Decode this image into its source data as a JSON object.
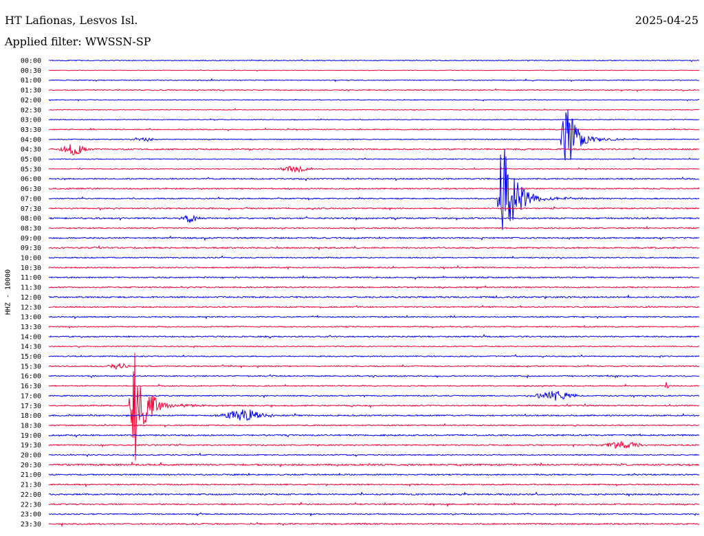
{
  "header": {
    "station": "HT Lafionas, Lesvos Isl.",
    "date": "2025-04-25",
    "filter_line": "Applied filter: WWSSN-SP",
    "channel_label": "HHZ - 10000"
  },
  "colors": {
    "even_trace": "#0000ee",
    "odd_trace": "#ee0033",
    "background": "#ffffff"
  },
  "chart_data": {
    "type": "line",
    "title": "HT Lafionas, Lesvos Isl.",
    "subtitle": "Applied filter: WWSSN-SP",
    "ylabel": "HHZ - 10000",
    "row_minutes": 30,
    "row_labels": [
      "00:00",
      "00:30",
      "01:00",
      "01:30",
      "02:00",
      "02:30",
      "03:00",
      "03:30",
      "04:00",
      "04:30",
      "05:00",
      "05:30",
      "06:00",
      "06:30",
      "07:00",
      "07:30",
      "08:00",
      "08:30",
      "09:00",
      "09:30",
      "10:00",
      "10:30",
      "11:00",
      "11:30",
      "12:00",
      "12:30",
      "13:00",
      "13:30",
      "14:00",
      "14:30",
      "15:00",
      "15:30",
      "16:00",
      "16:30",
      "17:00",
      "17:30",
      "18:00",
      "18:30",
      "19:00",
      "19:30",
      "20:00",
      "20:30",
      "21:00",
      "21:30",
      "22:00",
      "22:30",
      "23:00",
      "23:30"
    ],
    "noise_level": [
      0.6,
      0.4,
      0.6,
      0.7,
      0.5,
      0.5,
      0.5,
      0.7,
      0.6,
      1.0,
      0.6,
      0.6,
      0.9,
      0.9,
      0.8,
      0.9,
      1.0,
      0.9,
      1.0,
      1.0,
      0.8,
      0.9,
      0.9,
      0.9,
      1.0,
      0.9,
      0.8,
      0.8,
      0.9,
      0.7,
      0.8,
      0.8,
      0.8,
      0.8,
      0.8,
      0.9,
      0.9,
      0.8,
      1.0,
      0.9,
      0.8,
      1.2,
      0.9,
      0.9,
      1.0,
      0.9,
      0.8,
      1.0
    ],
    "events": [
      {
        "row": 8,
        "minute": 3.6,
        "amplitude": 3,
        "duration_min": 1.5,
        "kind": "burst"
      },
      {
        "row": 9,
        "minute": 0.4,
        "amplitude": 8,
        "duration_min": 1.5,
        "kind": "burst"
      },
      {
        "row": 11,
        "minute": 10.5,
        "amplitude": 5,
        "duration_min": 1.8,
        "kind": "burst"
      },
      {
        "row": 14,
        "minute": 12.0,
        "amplitude": 4,
        "duration_min": 0.3,
        "kind": "spike"
      },
      {
        "row": 16,
        "minute": 6.0,
        "amplitude": 6,
        "duration_min": 1.0,
        "kind": "burst"
      },
      {
        "row": 14,
        "minute": 20.8,
        "amplitude": 110,
        "duration_min": 2.5,
        "kind": "quake"
      },
      {
        "row": 8,
        "minute": 23.7,
        "amplitude": 70,
        "duration_min": 2.4,
        "kind": "quake"
      },
      {
        "row": 33,
        "minute": 28.5,
        "amplitude": 9,
        "duration_min": 0.2,
        "kind": "spike"
      },
      {
        "row": 35,
        "minute": 3.8,
        "amplitude": 120,
        "duration_min": 2.2,
        "kind": "quake"
      },
      {
        "row": 31,
        "minute": 2.6,
        "amplitude": 4,
        "duration_min": 1.2,
        "kind": "burst"
      },
      {
        "row": 36,
        "minute": 7.8,
        "amplitude": 9,
        "duration_min": 2.5,
        "kind": "burst"
      },
      {
        "row": 34,
        "minute": 22.3,
        "amplitude": 8,
        "duration_min": 2.0,
        "kind": "burst"
      },
      {
        "row": 39,
        "minute": 25.3,
        "amplitude": 5,
        "duration_min": 2.4,
        "kind": "burst"
      }
    ]
  }
}
